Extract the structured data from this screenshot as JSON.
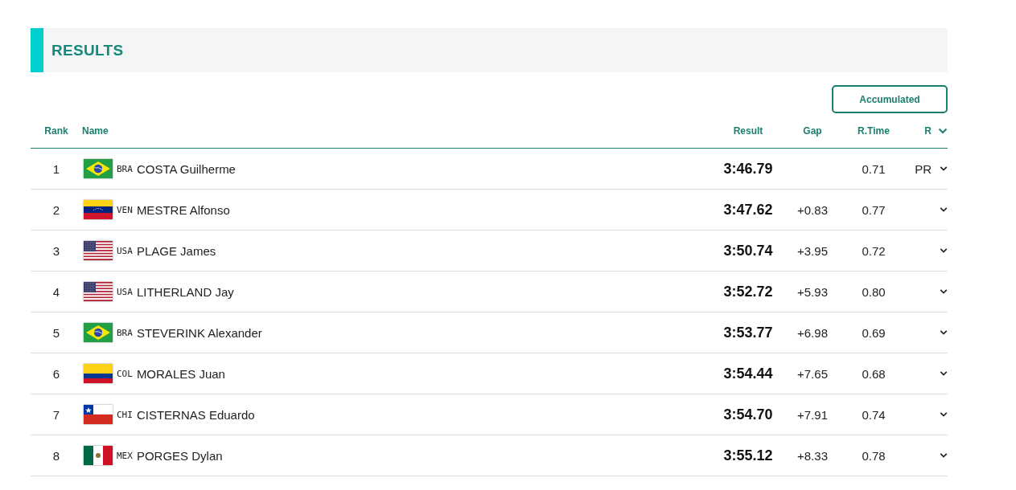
{
  "section": {
    "title": "RESULTS"
  },
  "toggle_button": {
    "label": "Accumulated"
  },
  "table": {
    "columns": [
      "Rank",
      "Name",
      "Result",
      "Gap",
      "R.Time",
      "R"
    ],
    "rows": [
      {
        "rank": "1",
        "kind": "brazil",
        "country": "BRA",
        "name": "COSTA Guilherme",
        "result": "3:46.79",
        "gap": "",
        "rtime": "0.71",
        "r": "PR"
      },
      {
        "rank": "2",
        "kind": "venezuela",
        "country": "VEN",
        "name": "MESTRE Alfonso",
        "result": "3:47.62",
        "gap": "+0.83",
        "rtime": "0.77",
        "r": ""
      },
      {
        "rank": "3",
        "kind": "usa",
        "country": "USA",
        "name": "PLAGE James",
        "result": "3:50.74",
        "gap": "+3.95",
        "rtime": "0.72",
        "r": ""
      },
      {
        "rank": "4",
        "kind": "usa",
        "country": "USA",
        "name": "LITHERLAND Jay",
        "result": "3:52.72",
        "gap": "+5.93",
        "rtime": "0.80",
        "r": ""
      },
      {
        "rank": "5",
        "kind": "brazil",
        "country": "BRA",
        "name": "STEVERINK Alexander",
        "result": "3:53.77",
        "gap": "+6.98",
        "rtime": "0.69",
        "r": ""
      },
      {
        "rank": "6",
        "kind": "colombia",
        "country": "COL",
        "name": "MORALES Juan",
        "result": "3:54.44",
        "gap": "+7.65",
        "rtime": "0.68",
        "r": ""
      },
      {
        "rank": "7",
        "kind": "chile",
        "country": "CHI",
        "name": "CISTERNAS Eduardo",
        "result": "3:54.70",
        "gap": "+7.91",
        "rtime": "0.74",
        "r": ""
      },
      {
        "rank": "8",
        "kind": "mexico",
        "country": "MEX",
        "name": "PORGES Dylan",
        "result": "3:55.12",
        "gap": "+8.33",
        "rtime": "0.78",
        "r": ""
      }
    ]
  }
}
